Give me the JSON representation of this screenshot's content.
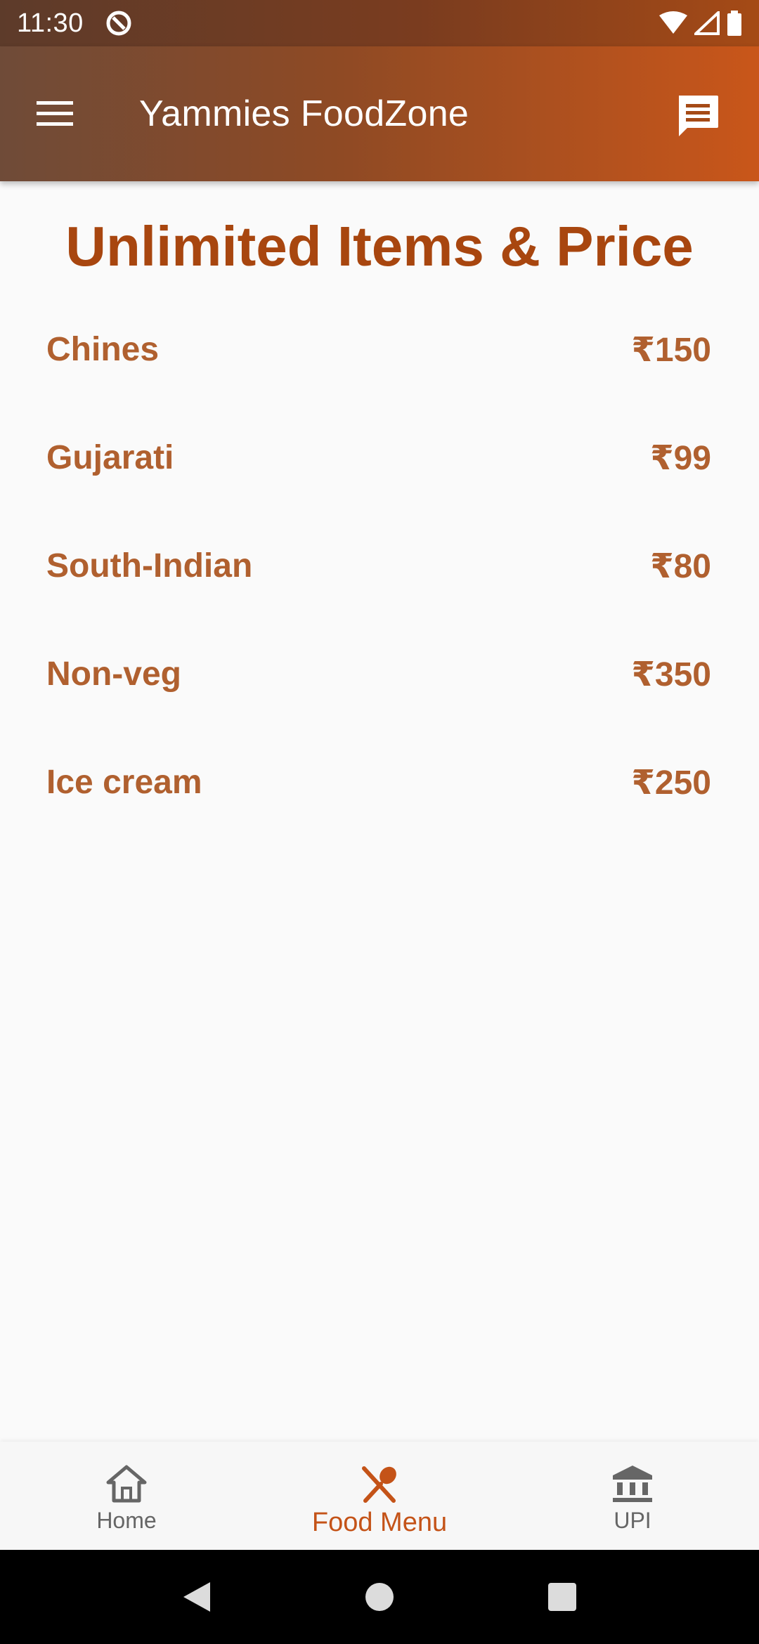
{
  "status_bar": {
    "time": "11:30"
  },
  "app_bar": {
    "title": "Yammies FoodZone"
  },
  "page": {
    "heading": "Unlimited Items & Price"
  },
  "menu_items": [
    {
      "name": "Chines",
      "price": "₹150"
    },
    {
      "name": "Gujarati",
      "price": "₹99"
    },
    {
      "name": "South-Indian",
      "price": "₹80"
    },
    {
      "name": "Non-veg",
      "price": "₹350"
    },
    {
      "name": "Ice cream",
      "price": "₹250"
    }
  ],
  "bottom_nav": {
    "items": [
      {
        "label": "Home",
        "icon": "home-icon",
        "active": false
      },
      {
        "label": "Food Menu",
        "icon": "fork-spoon-icon",
        "active": true
      },
      {
        "label": "UPI",
        "icon": "bank-icon",
        "active": false
      }
    ]
  },
  "colors": {
    "accent": "#c45318",
    "heading": "#a8460f",
    "item_text": "#b0602f"
  }
}
